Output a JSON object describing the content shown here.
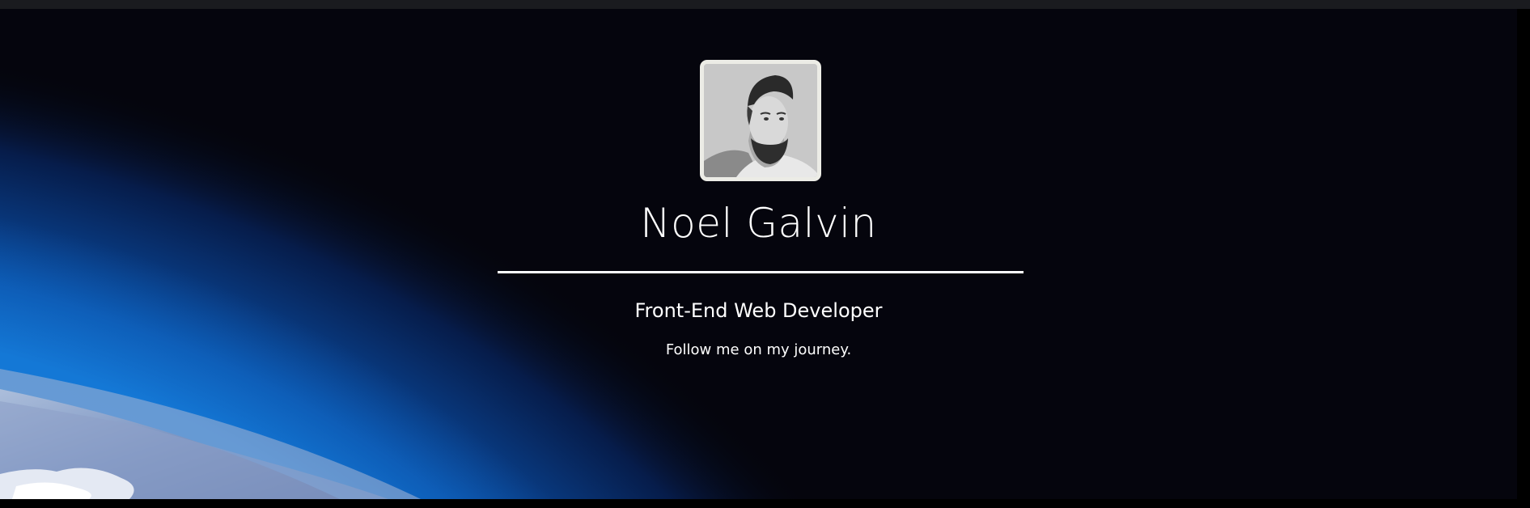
{
  "hero": {
    "name": "Noel Galvin",
    "role": "Front-End Web Developer",
    "tagline": "Follow me on my journey.",
    "avatar_icon": "profile-photo-icon",
    "background": "earth-from-space"
  },
  "colors": {
    "page_background": "#000000",
    "top_bar": "#1a1b1f",
    "sky": "#05050d",
    "atmosphere_blue": "#0a7bd8",
    "text": "#ffffff",
    "avatar_border": "#ecece6"
  }
}
